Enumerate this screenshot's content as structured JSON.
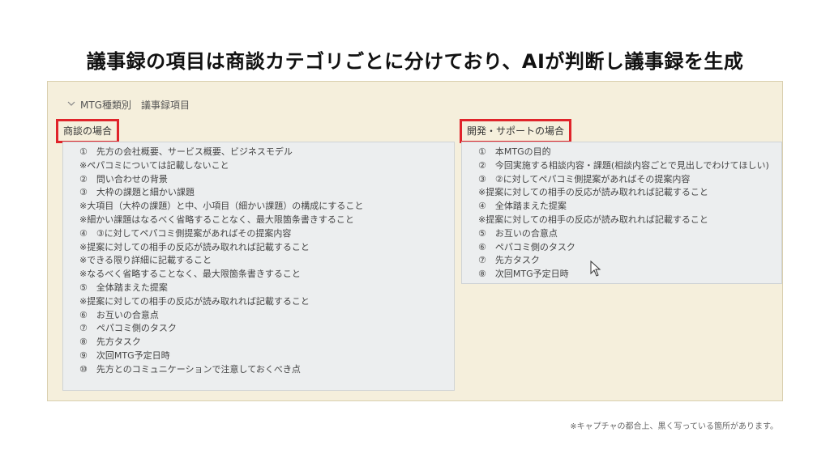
{
  "headline": "議事録の項目は商談カテゴリごとに分けており、AIが判断し議事録を生成",
  "section_title": "MTG種類別　議事録項目",
  "left_panel": {
    "label": "商談の場合",
    "items": [
      "①　先方の会社概要、サービス概要、ビジネスモデル",
      "※ペパコミについては記載しないこと",
      "②　問い合わせの背景",
      "③　大枠の課題と細かい課題",
      "※大項目（大枠の課題）と中、小項目（細かい課題）の構成にすること",
      "※細かい課題はなるべく省略することなく、最大限箇条書きすること",
      "④　③に対してペパコミ側提案があればその提案内容",
      "※提案に対しての相手の反応が読み取れれば記載すること",
      "※できる限り詳細に記載すること",
      "※なるべく省略することなく、最大限箇条書きすること",
      "⑤　全体踏まえた提案",
      "※提案に対しての相手の反応が読み取れれば記載すること",
      "⑥　お互いの合意点",
      "⑦　ペパコミ側のタスク",
      "⑧　先方タスク",
      "⑨　次回MTG予定日時",
      "⑩　先方とのコミュニケーションで注意しておくべき点"
    ]
  },
  "right_panel": {
    "label": "開発・サポートの場合",
    "items": [
      "①　本MTGの目的",
      "②　今回実施する相談内容・課題(相談内容ごとで見出しでわけてほしい)",
      "③　②に対してペパコミ側提案があればその提案内容",
      "※提案に対しての相手の反応が読み取れれば記載すること",
      "④　全体踏まえた提案",
      "※提案に対しての相手の反応が読み取れれば記載すること",
      "⑤　お互いの合意点",
      "⑥　ペパコミ側のタスク",
      "⑦　先方タスク",
      "⑧　次回MTG予定日時"
    ]
  },
  "caption": "※キャプチャの都合上、黒く写っている箇所があります。",
  "icons": {
    "section_toggle": "chevron-down-icon",
    "pointer": "mouse-cursor-icon"
  },
  "colors": {
    "highlight_border": "#e0242a",
    "panel_background": "#f5efdc"
  }
}
